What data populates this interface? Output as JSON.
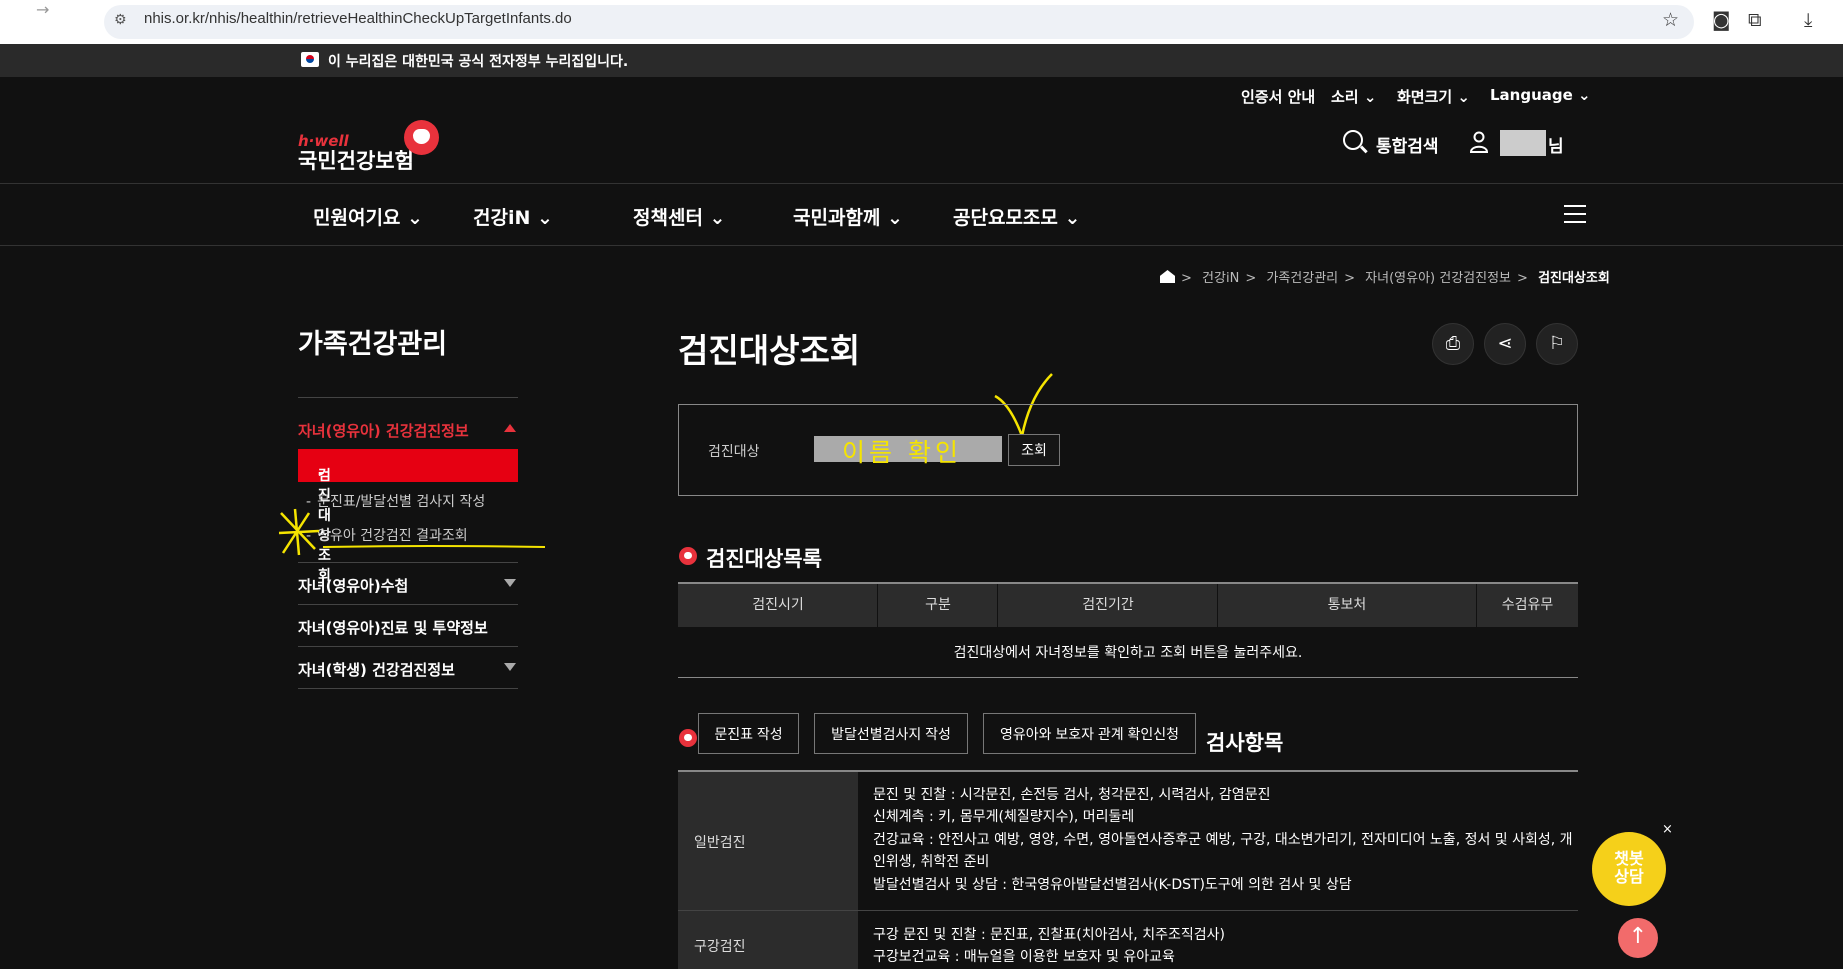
{
  "browser": {
    "url": "nhis.or.kr/nhis/healthin/retrieveHealthinCheckUpTargetInfants.do"
  },
  "gov_banner": {
    "text": "이 누리집은 대한민국 공식 전자정부 누리집입니다."
  },
  "header": {
    "utilities": [
      "인증서 안내",
      "소리",
      "화면크기",
      "Language"
    ],
    "logo_sub": "h·well",
    "logo_main": "국민건강보험",
    "search_label": "통합검색",
    "user_suffix": "님"
  },
  "gnb": [
    "민원여기요",
    "건강iN",
    "정책센터",
    "국민과함께",
    "공단요모조모"
  ],
  "breadcrumb": [
    "건강iN",
    "가족건강관리",
    "자녀(영유아) 건강검진정보",
    "검진대상조회"
  ],
  "sidebar": {
    "title": "가족건강관리",
    "group1": "자녀(영유아) 건강검진정보",
    "active_item": "검진대상조회",
    "sub_items": [
      "문진표/발달선별 검사지 작성",
      "영유아 건강검진 결과조회"
    ],
    "groups": [
      "자녀(영유아)수첩",
      "자녀(영유아)진료 및 투약정보",
      "자녀(학생) 건강검진정보"
    ]
  },
  "main": {
    "title": "검진대상조회",
    "search": {
      "label": "검진대상",
      "name_annotation": "이름 확인",
      "query_button": "조회"
    },
    "list_title": "검진대상목록",
    "table_headers": [
      "검진시기",
      "구분",
      "검진기간",
      "통보처",
      "수검유무"
    ],
    "table_message": "검진대상에서 자녀정보를 확인하고 조회 버튼을 눌러주세요.",
    "action_buttons": [
      "문진표 작성",
      "발달선별검사지 작성",
      "영유아와 보호자 관계 확인신청"
    ],
    "items_title": "검사항목",
    "items": [
      {
        "name": "일반검진",
        "lines": [
          "문진 및 진찰 : 시각문진, 손전등 검사, 청각문진, 시력검사, 감염문진",
          "신체계측 : 키, 몸무게(체질량지수), 머리둘레",
          "건강교육 : 안전사고 예방, 영양, 수면, 영아돌연사증후군 예방, 구강, 대소변가리기, 전자미디어 노출, 정서 및 사회성, 개",
          "인위생, 취학전 준비",
          "발달선별검사 및 상담 : 한국영유아발달선별검사(K-DST)도구에 의한 검사 및 상담"
        ]
      },
      {
        "name": "구강검진",
        "lines": [
          "구강 문진 및 진찰 : 문진표, 진찰표(치아검사, 치주조직검사)",
          "구강보건교육 : 매뉴얼을 이용한 보호자 및 유아교육"
        ]
      }
    ]
  },
  "floating": {
    "chatbot_label": "챗봇\n상담",
    "chatbot_close": "×",
    "top_arrow": "↑"
  },
  "colors": {
    "accent_red": "#e60012",
    "brand_red": "#e8323c",
    "chatbot_yellow": "#f5d01a",
    "annotation_yellow": "#f5e400"
  }
}
